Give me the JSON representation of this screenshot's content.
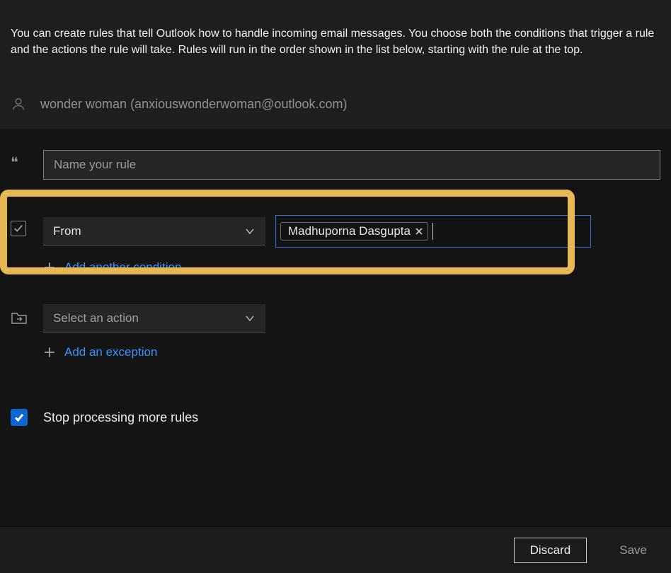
{
  "header": {
    "intro": "You can create rules that tell Outlook how to handle incoming email messages. You choose both the conditions that trigger a rule and the actions the rule will take. Rules will run in the order shown in the list below, starting with the rule at the top.",
    "account": "wonder woman (anxiouswonderwoman@outlook.com)"
  },
  "rule_name": {
    "placeholder": "Name your rule",
    "value": ""
  },
  "condition": {
    "selector_label": "From",
    "chip_name": "Madhuporna Dasgupta",
    "add_link": "Add another condition"
  },
  "action": {
    "selector_placeholder": "Select an action",
    "add_exception_link": "Add an exception"
  },
  "stop_processing": {
    "label": "Stop processing more rules",
    "checked": true
  },
  "footer": {
    "discard": "Discard",
    "save": "Save"
  }
}
